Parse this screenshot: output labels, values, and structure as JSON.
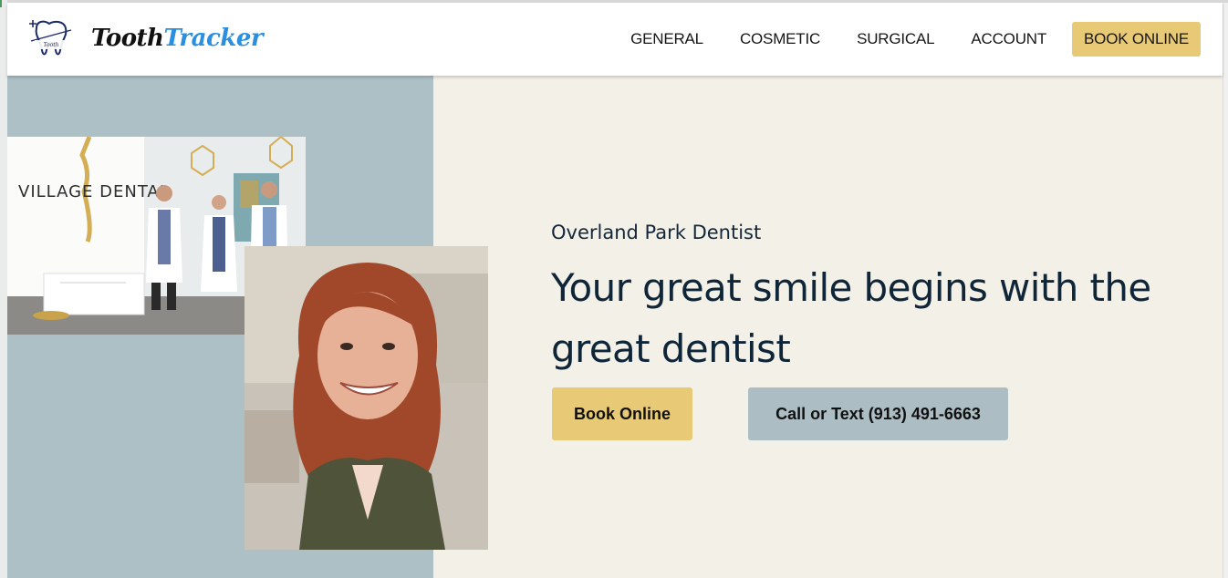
{
  "brand": {
    "logo_text_part1": "Tooth",
    "logo_text_part2": "Tracker",
    "logo_icon": "tooth-logo-icon",
    "accent_color": "#2b8fe0"
  },
  "nav": {
    "items": [
      {
        "label": "GENERAL"
      },
      {
        "label": "COSMETIC"
      },
      {
        "label": "SURGICAL"
      },
      {
        "label": "ACCOUNT"
      }
    ],
    "cta_label": "BOOK ONLINE",
    "cta_color": "#e8c976"
  },
  "photos": {
    "office_sign_text": "VILLAGE DENTAL"
  },
  "hero": {
    "eyebrow": "Overland Park Dentist",
    "title": "Your great smile begins with the great dentist",
    "primary_button": "Book Online",
    "secondary_button": "Call or Text (913) 491-6663",
    "left_panel_color": "#acc0c6",
    "right_panel_color": "#f3f0e8"
  }
}
